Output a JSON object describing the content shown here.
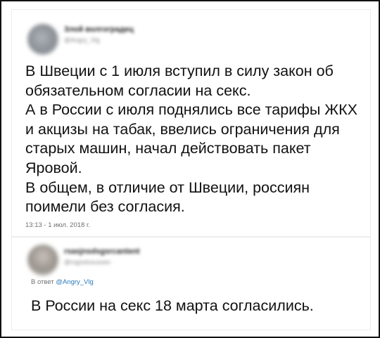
{
  "tweet": {
    "author_name": "Злой волгоградец",
    "author_handle": "@Angry_Vlg",
    "paragraphs": [
      "В Швеции с 1 июля вступил в силу закон об обязательном согласии на секс.",
      "А в России с июля поднялись все тарифы ЖКХ и акцизы на табак, ввелись ограничения для старых машин, начал действовать пакет Яровой.",
      "В общем, в отличие от Швеции, россиян поимели без согласия."
    ],
    "timestamp": "13:13 - 1 июл. 2018 г."
  },
  "reply": {
    "author_name": "rsasjnsdsgsrcantent",
    "author_handle": "@rsgsstosusses",
    "reply_prefix": "В ответ",
    "reply_mention": "@Angry_Vlg",
    "text": "В России на секс 18 марта согласились."
  },
  "colors": {
    "text": "#111111",
    "meta": "#707070",
    "mention": "#2b7bb9",
    "frame_border": "#111111"
  }
}
